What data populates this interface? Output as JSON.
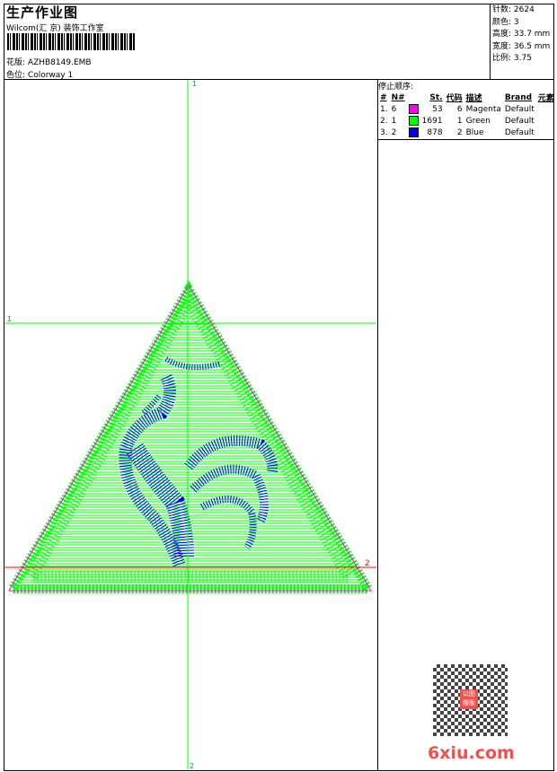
{
  "header": {
    "title": "生产作业图",
    "company": "Wilcom(汇 京) 装饰工作室",
    "design_label": "花版:",
    "design_value": "AZHB8149.EMB",
    "colorway_label": "色位:",
    "colorway_value": "Colorway 1"
  },
  "stats": {
    "stitches": "针数: 2624",
    "colors": "颜色: 3",
    "height": "高度: 33.7 mm",
    "width": "宽度: 36.5 mm",
    "scale": "比例: 3.75"
  },
  "stop_sequence": {
    "title": "停止顺序:",
    "columns": [
      "#",
      "N#",
      "",
      "St.",
      "代码",
      "描述",
      "Brand",
      "元素"
    ],
    "rows": [
      {
        "idx": "1.",
        "n": "6",
        "color": "#ff00ff",
        "st": "53",
        "code": "6",
        "desc": "Magenta",
        "brand": "Default"
      },
      {
        "idx": "2.",
        "n": "1",
        "color": "#00ff00",
        "st": "1691",
        "code": "1",
        "desc": "Green",
        "brand": "Default"
      },
      {
        "idx": "3.",
        "n": "2",
        "color": "#0000ff",
        "st": "878",
        "code": "2",
        "desc": "Blue",
        "brand": "Default"
      }
    ]
  },
  "canvas": {
    "axis_v_top": "1",
    "axis_v_bottom": "2",
    "axis_h1": "1",
    "axis_h2": "2"
  },
  "watermark": {
    "text": "6xiu.com",
    "seal": "以图搜版"
  },
  "colors": {
    "green": "#00ff00",
    "red": "#ff0000",
    "magenta": "#ff00ff",
    "blue": "#0000ff"
  }
}
